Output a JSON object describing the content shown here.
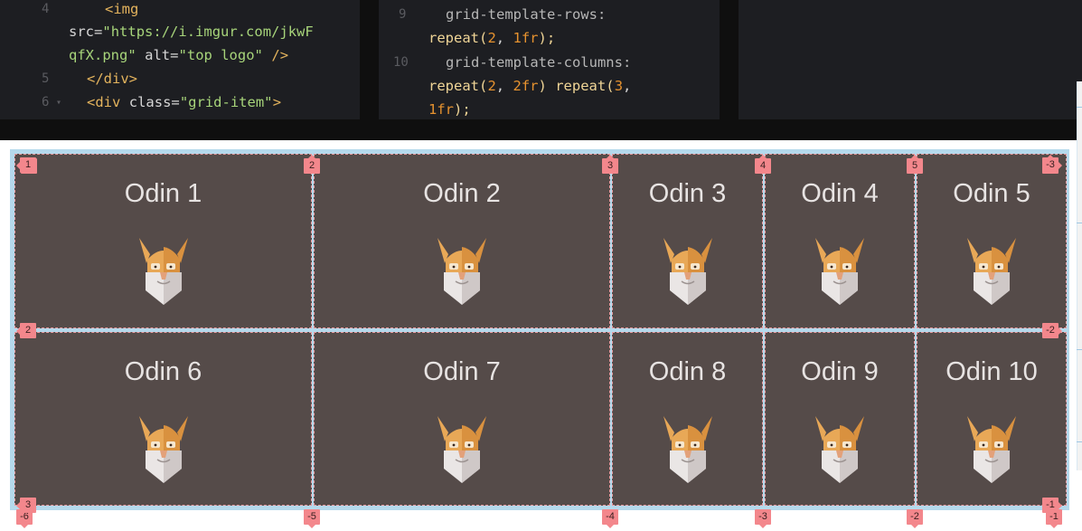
{
  "editor": {
    "html_pane": {
      "lines": [
        {
          "num": "4",
          "fold": "",
          "tokens": [
            [
              "c-tag",
              "<img"
            ]
          ]
        },
        {
          "num": "",
          "fold": "",
          "tokens": [
            [
              "c-attr",
              "src="
            ],
            [
              "c-str",
              "\"https://i.imgur.com/jkwF"
            ]
          ]
        },
        {
          "num": "",
          "fold": "",
          "tokens": [
            [
              "c-str",
              "qfX.png\""
            ],
            [
              "c-attr",
              " alt="
            ],
            [
              "c-str",
              "\"top logo\""
            ],
            [
              "c-tag",
              " />"
            ]
          ]
        },
        {
          "num": "5",
          "fold": "",
          "tokens": [
            [
              "c-tag",
              "</div>"
            ]
          ]
        },
        {
          "num": "6",
          "fold": "▾",
          "tokens": [
            [
              "c-tag",
              "<div "
            ],
            [
              "c-attr",
              "class="
            ],
            [
              "c-str",
              "\"grid-item\""
            ],
            [
              "c-tag",
              ">"
            ]
          ]
        }
      ]
    },
    "css_pane": {
      "lines": [
        {
          "num": "9",
          "tokens": [
            [
              "c-prop",
              "grid-template-rows:"
            ]
          ]
        },
        {
          "num": "",
          "tokens": [
            [
              "c-val",
              "repeat("
            ],
            [
              "c-num",
              "2"
            ],
            [
              "c-punc",
              ", "
            ],
            [
              "c-num",
              "1fr"
            ],
            [
              "c-val",
              ");"
            ]
          ]
        },
        {
          "num": "10",
          "tokens": [
            [
              "c-prop",
              "grid-template-columns:"
            ]
          ]
        },
        {
          "num": "",
          "tokens": [
            [
              "c-val",
              "repeat("
            ],
            [
              "c-num",
              "2"
            ],
            [
              "c-punc",
              ", "
            ],
            [
              "c-num",
              "2fr"
            ],
            [
              "c-val",
              ") repeat("
            ],
            [
              "c-num",
              "3"
            ],
            [
              "c-punc",
              ","
            ]
          ]
        },
        {
          "num": "",
          "tokens": [
            [
              "c-num",
              "1fr"
            ],
            [
              "c-val",
              ");"
            ]
          ]
        }
      ]
    }
  },
  "grid": {
    "columns_template": "repeat(2, 2fr) repeat(3, 1fr)",
    "rows_template": "repeat(2, 1fr)",
    "items": [
      {
        "title": "Odin 1"
      },
      {
        "title": "Odin 2"
      },
      {
        "title": "Odin 3"
      },
      {
        "title": "Odin 4"
      },
      {
        "title": "Odin 5"
      },
      {
        "title": "Odin 6"
      },
      {
        "title": "Odin 7"
      },
      {
        "title": "Odin 8"
      },
      {
        "title": "Odin 9"
      },
      {
        "title": "Odin 10"
      }
    ],
    "image_alt": "top logo",
    "line_numbers": {
      "column_top": [
        "1",
        "2",
        "3",
        "4",
        "5",
        "-3"
      ],
      "column_bottom": [
        "-6",
        "-5",
        "-4",
        "-3",
        "-2",
        "-1"
      ],
      "row_left": [
        "1",
        "2",
        "3"
      ],
      "row_right": [
        "-3",
        "-2",
        "-1"
      ]
    }
  },
  "colors": {
    "editor_bg": "#1d1e22",
    "grid_container_bg": "#b5d9ec",
    "cell_bg": "#554b49",
    "cell_text": "#e7e3e2",
    "grid_line_badge": "#f3878c",
    "odin_helmet": "#e8a857",
    "odin_beard": "#d9d4d3"
  },
  "icons": {
    "cell_image": "odin-head-icon"
  }
}
